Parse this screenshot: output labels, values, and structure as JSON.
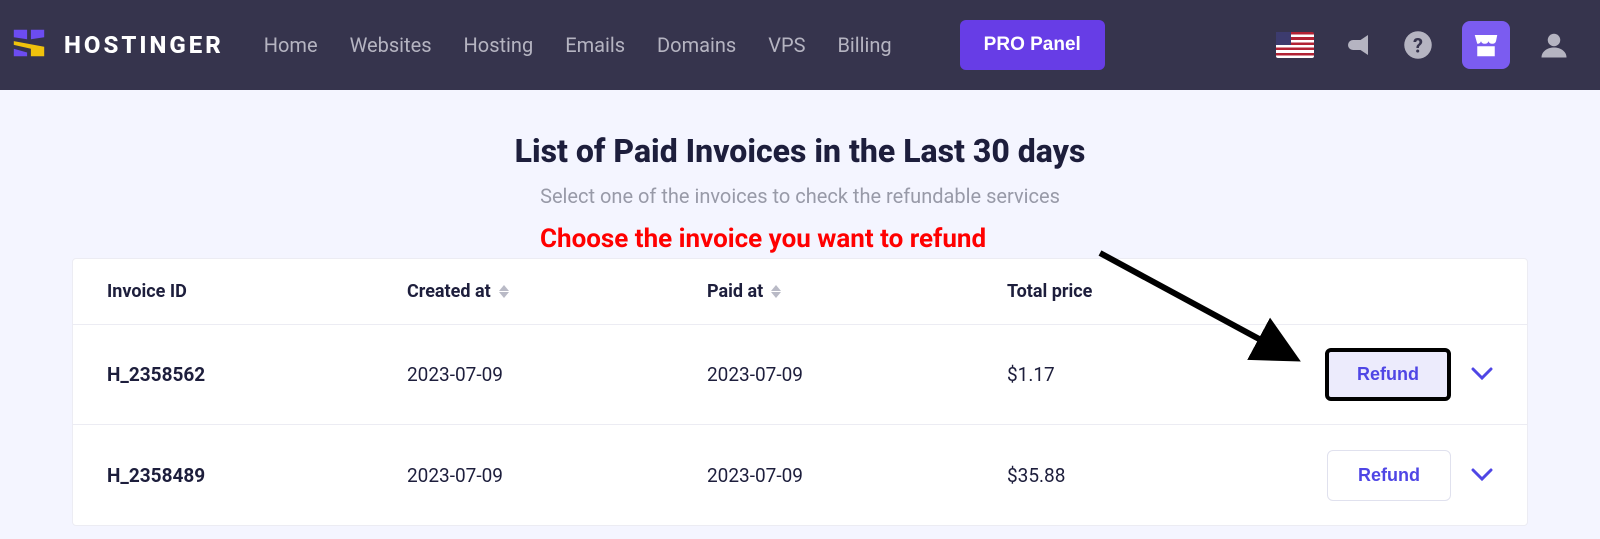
{
  "brand": {
    "name": "HOSTINGER"
  },
  "nav": {
    "home": "Home",
    "websites": "Websites",
    "hosting": "Hosting",
    "emails": "Emails",
    "domains": "Domains",
    "vps": "VPS",
    "billing": "Billing",
    "pro_panel": "PRO Panel"
  },
  "page": {
    "title": "List of Paid Invoices in the Last 30 days",
    "subtitle": "Select one of the invoices to check the refundable services"
  },
  "annotation": {
    "text": "Choose the invoice you want to refund"
  },
  "table": {
    "headers": {
      "invoice_id": "Invoice ID",
      "created_at": "Created at",
      "paid_at": "Paid at",
      "total_price": "Total price"
    },
    "rows": [
      {
        "invoice_id": "H_2358562",
        "created_at": "2023-07-09",
        "paid_at": "2023-07-09",
        "total_price": "$1.17",
        "refund_label": "Refund",
        "highlighted": true
      },
      {
        "invoice_id": "H_2358489",
        "created_at": "2023-07-09",
        "paid_at": "2023-07-09",
        "total_price": "$35.88",
        "refund_label": "Refund",
        "highlighted": false
      }
    ]
  }
}
